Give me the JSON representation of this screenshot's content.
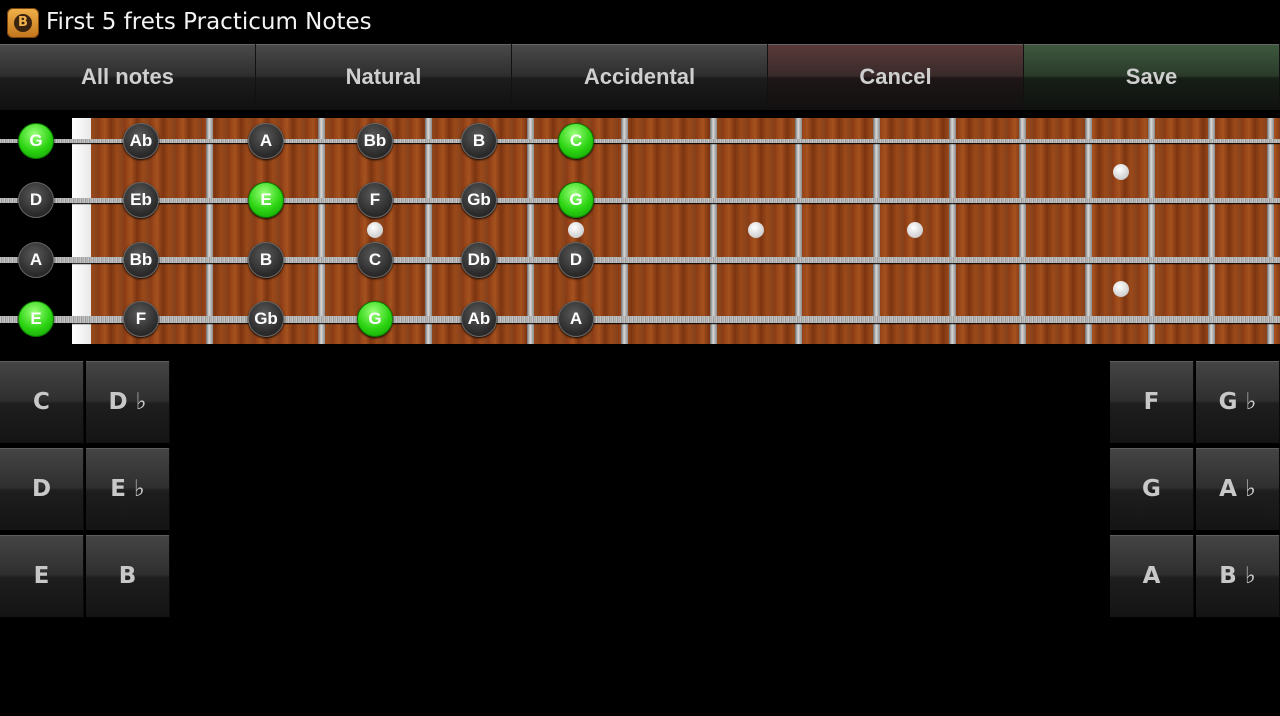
{
  "app": {
    "title": "First 5 frets Practicum Notes",
    "icon_letter": "B"
  },
  "toolbar": {
    "all_notes": "All notes",
    "natural": "Natural",
    "accidental": "Accidental",
    "cancel": "Cancel",
    "save": "Save"
  },
  "fretboard": {
    "strings": [
      {
        "open": "G",
        "notes": [
          "Ab",
          "A",
          "Bb",
          "B",
          "C"
        ],
        "highlighted": [
          "G",
          "C"
        ]
      },
      {
        "open": "D",
        "notes": [
          "Eb",
          "E",
          "F",
          "Gb",
          "G"
        ],
        "highlighted": [
          "E",
          "G"
        ]
      },
      {
        "open": "A",
        "notes": [
          "Bb",
          "B",
          "C",
          "Db",
          "D"
        ],
        "highlighted": []
      },
      {
        "open": "E",
        "notes": [
          "F",
          "Gb",
          "G",
          "Ab",
          "A"
        ],
        "highlighted": [
          "E",
          "G"
        ]
      }
    ]
  },
  "pads": {
    "left": [
      "C",
      "D ♭",
      "D",
      "E ♭",
      "E",
      "B"
    ],
    "right": [
      "F",
      "G ♭",
      "G",
      "A ♭",
      "A",
      "B ♭"
    ]
  },
  "colors": {
    "highlight": "#2bd411",
    "fretboard_wood": "#8a3a14"
  }
}
